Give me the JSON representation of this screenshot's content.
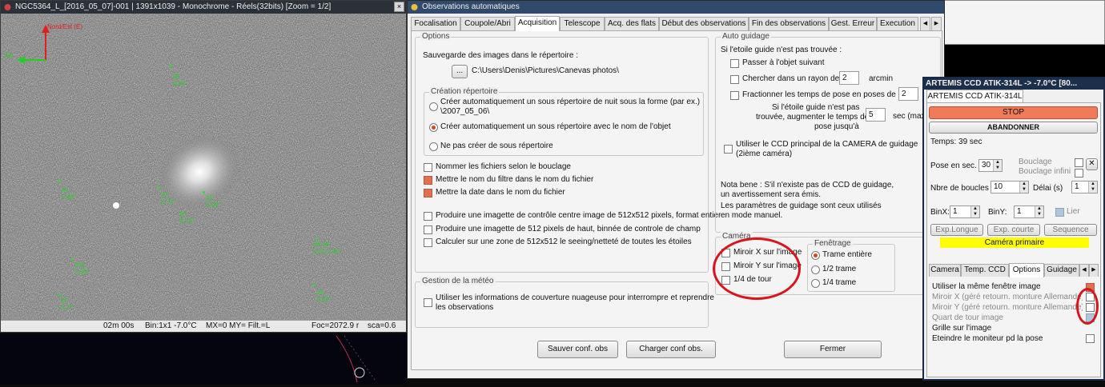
{
  "image_window": {
    "title": "NGC5364_L_[2016_05_07]-001 | 1391x1039 - Monochrome - Réels(32bits)  [Zoom = 1/2]",
    "north_label": "Nord/Est (E)",
    "west_label": "(N)",
    "stars": [
      {
        "id": "#4",
        "val": "0.00\""
      },
      {
        "id": "#1",
        "val": "0.00\""
      },
      {
        "id": "#2",
        "val": "0.74\""
      },
      {
        "id": "#3",
        "val": "0.33\""
      },
      {
        "id": "#1",
        "val": "0.00\""
      },
      {
        "id": "#6 #8",
        "val": "0.01 0.01\""
      },
      {
        "id": "#10",
        "val": "0.30\""
      },
      {
        "id": "#7",
        "val": "0.27\""
      },
      {
        "id": "#5",
        "val": "0.01\""
      }
    ],
    "status": {
      "time": "02m 00s",
      "bin": "Bin:1x1  -7.0°C",
      "mirror": "MX=0 MY= Filt.=L",
      "foc": "Foc=2072.9 r",
      "sca": "sca=0.6"
    }
  },
  "obs_window": {
    "title": "Observations automatiques",
    "tabs": [
      "Focalisation",
      "Coupole/Abri",
      "Acquisition",
      "Telescope",
      "Acq. des flats",
      "Début des observations",
      "Fin des observations",
      "Gest. Erreur",
      "Execution"
    ],
    "active_tab": "Acquisition",
    "options": {
      "legend": "Options",
      "save_label": "Sauvegarde des images dans le répertoire :",
      "browse": "...",
      "path": "C:\\Users\\Denis\\Pictures\\Canevas photos\\",
      "creation_legend": "Création répertoire",
      "radio1": "Créer automatiquement un sous répertoire de nuit sous la forme (par ex.)",
      "radio1b": "\\2007_05_06\\",
      "radio2": "Créer automatiquement un sous répertoire avec le nom de l'objet",
      "radio3": "Ne pas créer de sous répertoire",
      "cb1": "Nommer les fichiers selon le bouclage",
      "cb2": "Mettre le nom du filtre dans le nom du fichier",
      "cb3": "Mettre la date dans le nom du fichier",
      "cb4": "Produire une imagette de contrôle centre image de 512x512 pixels, format entier",
      "cb5": "Produire une imagette de 512 pixels de haut, binnée de controle de champ",
      "cb6": "Calculer sur une zone de 512x512 le seeing/netteté de toutes les étoiles"
    },
    "meteo": {
      "legend": "Gestion de la météo",
      "cb": "Utiliser les informations de couverture nuageuse pour interrompre et reprendre",
      "cb_b": "les observations"
    },
    "guide": {
      "legend": "Auto guidage",
      "intro": "Si l'etoile guide n'est pas trouvée :",
      "cb1": "Passer à l'objet suivant",
      "cb2": "Chercher dans un rayon de",
      "radius": "2",
      "radius_unit": "arcmin",
      "cb3": "Fractionner les temps de pose en poses de",
      "frac": "2",
      "txt1": "Si l'étoile guide n'est pas",
      "txt2": "trouvée, augmenter le temps de",
      "txt3": "pose jusqu'à",
      "maxval": "5",
      "maxunit": "sec (max",
      "cb4": "Utiliser le CCD principal de la CAMERA de guidage",
      "cb4b": "(2ième caméra)",
      "note1": "Nota bene : S'il n'existe pas de CCD de guidage,",
      "note2": "un avertissement sera émis.",
      "note3": "Les paramètres de guidage sont ceux utilisés",
      "note4": "en mode manuel."
    },
    "camera": {
      "legend": "Caméra",
      "cb1": "Miroir X sur l'image",
      "cb2": "Miroir Y sur l'image",
      "cb3": "1/4 de tour"
    },
    "fenetrage": {
      "legend": "Fenêtrage",
      "r1": "Trame entière",
      "r2": "1/2 trame",
      "r3": "1/4 trame"
    },
    "buttons": {
      "save": "Sauver conf. obs",
      "load": "Charger conf obs.",
      "close": "Fermer"
    }
  },
  "ccd_window": {
    "title": "ARTEMIS CCD ATIK-314L   ->  -7.0°C  [80...",
    "tab": "ARTEMIS CCD ATIK-314L",
    "stop": "STOP",
    "abandon": "ABANDONNER",
    "temps": "Temps: 39 sec",
    "pose_label": "Pose en sec.",
    "pose": "30",
    "bouclage": "Bouclage",
    "bouclage_infini": "Bouclage infini",
    "nbre_label": "Nbre de boucles",
    "nbre": "10",
    "delai_label": "Délai (s)",
    "delai": "1",
    "binx_label": "BinX:",
    "binx": "1",
    "biny_label": "BinY:",
    "biny": "1",
    "lier": "Lier",
    "exp_longue": "Exp.Longue",
    "exp_courte": "Exp. courte",
    "sequence": "Sequence",
    "camera_primaire": "Caméra primaire",
    "tabs": [
      "Camera",
      "Temp. CCD",
      "Options",
      "Guidage"
    ],
    "active_tab": "Options",
    "opt1": "Utiliser la même fenêtre image",
    "opt2": "Miroir X (géré retourn. monture Allemande)",
    "opt3": "Miroir Y (géré retourn. monture Allemande)",
    "opt4": "Quart de tour image",
    "opt5": "Grille sur l'image",
    "opt6": "Eteindre le moniteur pd la pose"
  },
  "colors": {
    "title_bg": "#1c2f4a",
    "stop": "#f07a5a",
    "camera_primaire": "#ffff00",
    "highlight": "#d8141e",
    "star_marker": "#2be02b"
  }
}
